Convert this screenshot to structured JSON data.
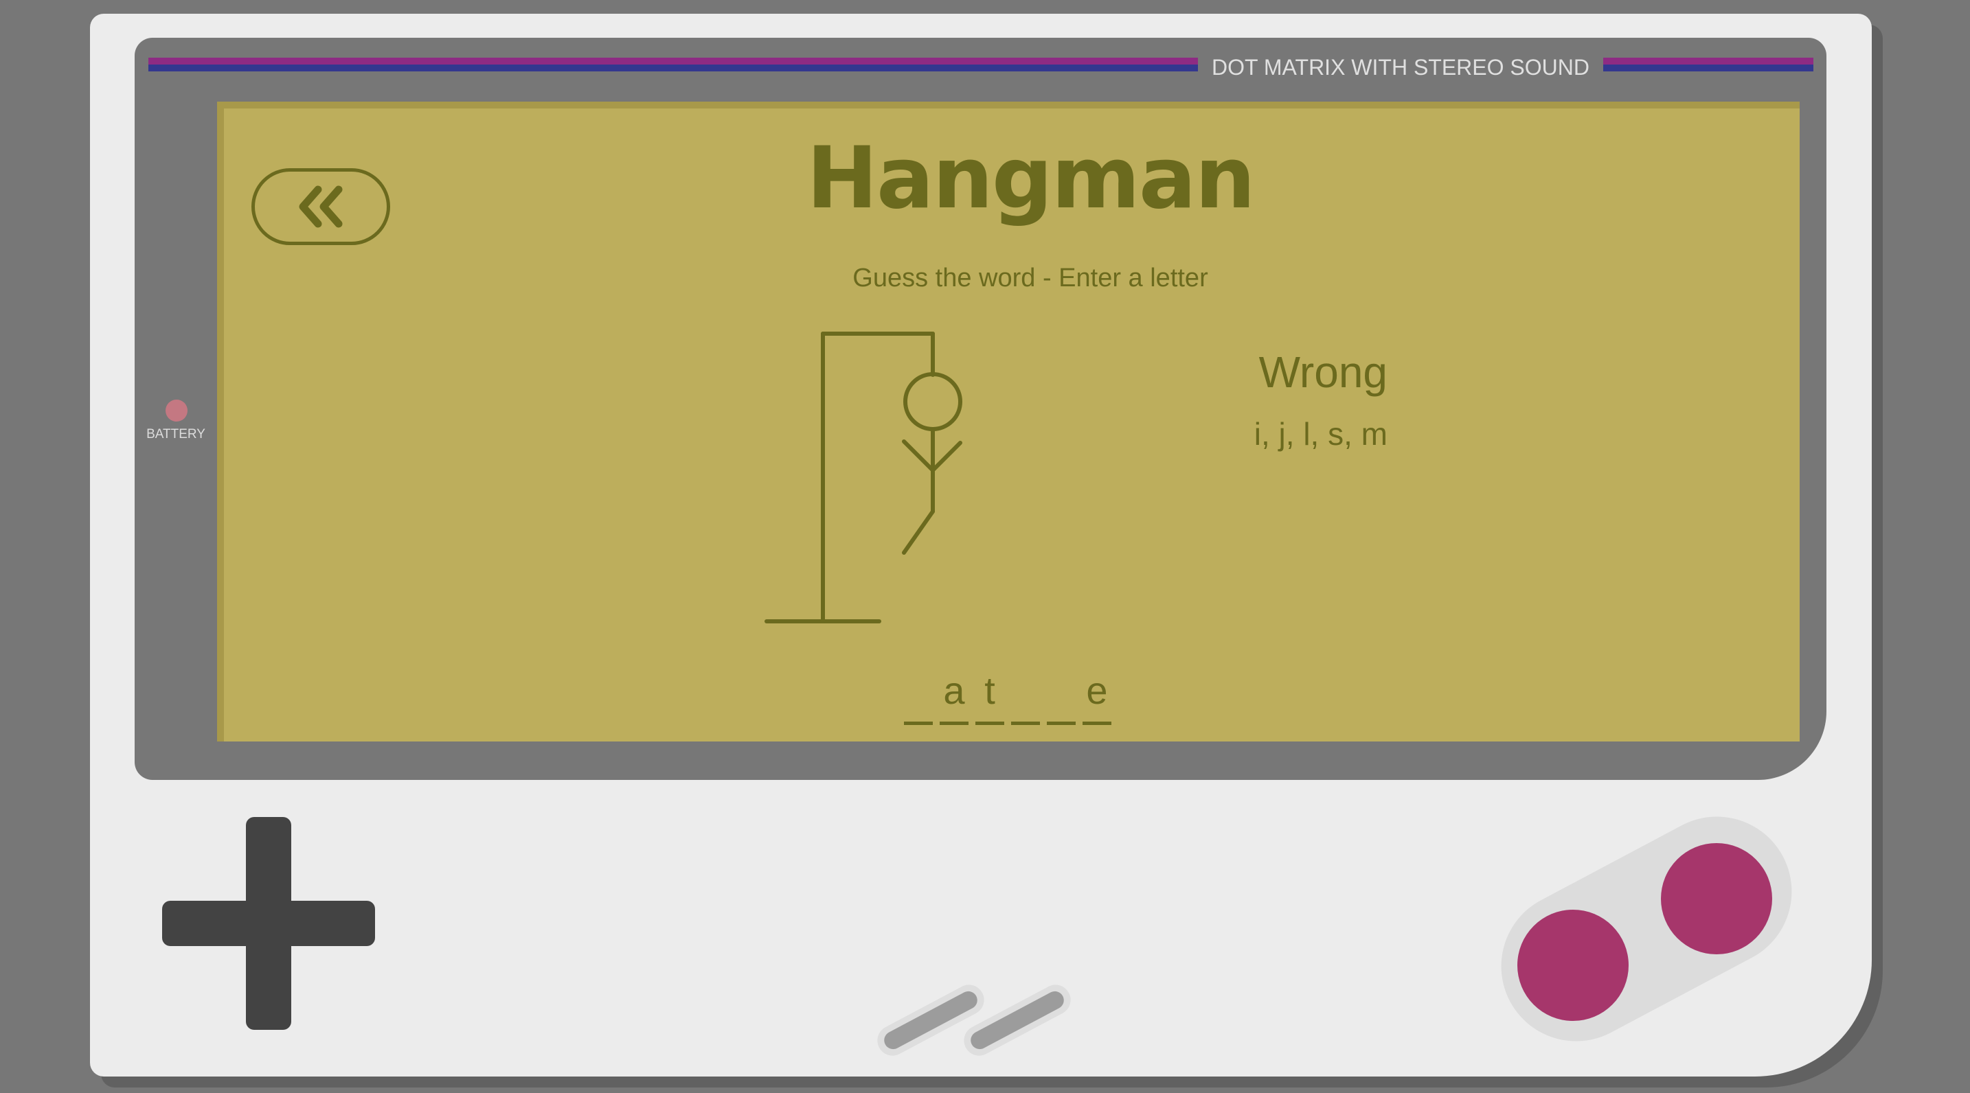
{
  "console": {
    "caption": "DOT MATRIX WITH STEREO SOUND",
    "battery_label": "BATTERY",
    "colors": {
      "body": "#ececec",
      "bezel": "#777777",
      "stripe_top": "#8e2b83",
      "stripe_bottom": "#33378f",
      "screen": "#bdae5c",
      "ink": "#6b6a1e",
      "battery_led": "#c47882",
      "action_buttons": "#a6366b",
      "dpad": "#434343"
    }
  },
  "game": {
    "title": "Hangman",
    "instruction": "Guess the word - Enter a letter",
    "back_button_icon": "double-chevron-left-icon",
    "wrong_label": "Wrong",
    "wrong_letters": "i, j, l, s, m",
    "wrong_count": 5,
    "word_slots": [
      "",
      "a",
      "t",
      "",
      "",
      "e"
    ]
  }
}
